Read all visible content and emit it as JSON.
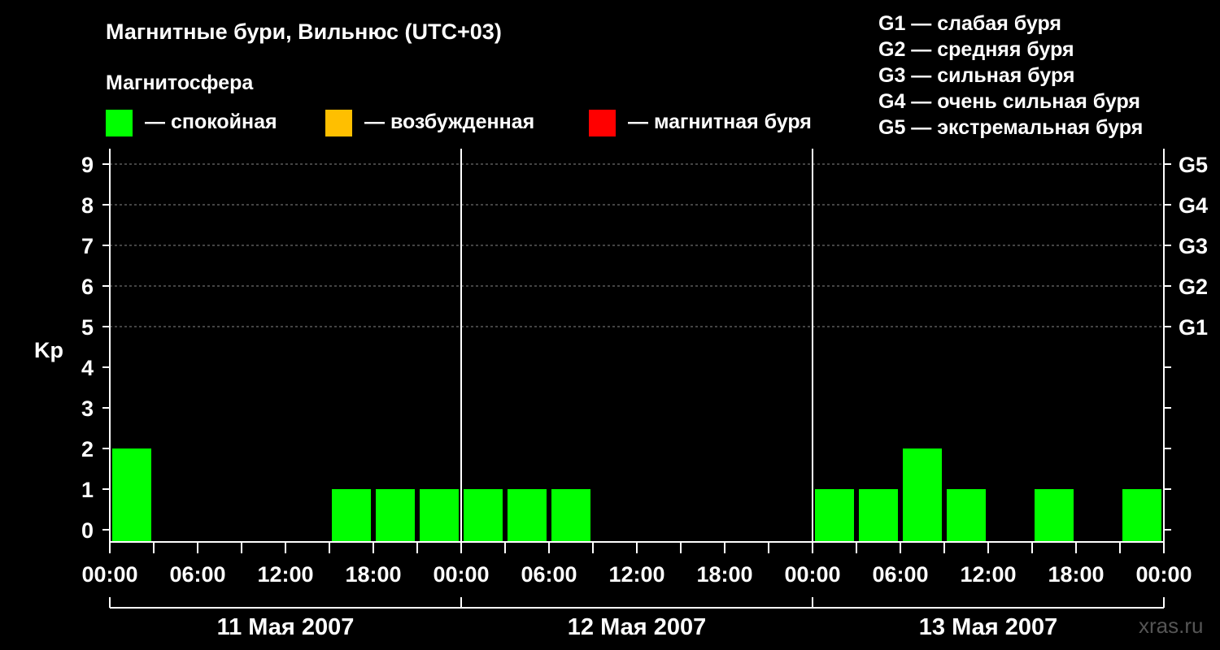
{
  "title": "Магнитные бури, Вильнюс (UTC+03)",
  "subtitle": "Магнитосфера",
  "state_legend": [
    {
      "label": "— спокойная",
      "color": "#00ff00"
    },
    {
      "label": "— возбужденная",
      "color": "#ffbf00"
    },
    {
      "label": "— магнитная буря",
      "color": "#ff0000"
    }
  ],
  "g_legend": [
    "G1 — слабая буря",
    "G2 — средняя буря",
    "G3 — сильная буря",
    "G4 — очень сильная буря",
    "G5 — экстремальная буря"
  ],
  "watermark": "xras.ru",
  "chart_data": {
    "type": "bar",
    "ylabel": "Kp",
    "ylim": [
      0,
      9
    ],
    "yticks": [
      "0",
      "1",
      "2",
      "3",
      "4",
      "5",
      "6",
      "7",
      "8",
      "9"
    ],
    "g_ticks": [
      {
        "kp": 5,
        "label": "G1"
      },
      {
        "kp": 6,
        "label": "G2"
      },
      {
        "kp": 7,
        "label": "G3"
      },
      {
        "kp": 8,
        "label": "G4"
      },
      {
        "kp": 9,
        "label": "G5"
      }
    ],
    "xtick_labels": [
      "00:00",
      "06:00",
      "12:00",
      "18:00",
      "00:00",
      "06:00",
      "12:00",
      "18:00",
      "00:00",
      "06:00",
      "12:00",
      "18:00",
      "00:00"
    ],
    "days": [
      "11 Мая 2007",
      "12 Мая 2007",
      "13 Мая 2007"
    ],
    "interval_hours": 3,
    "grid": true,
    "series": [
      {
        "values": [
          2,
          0,
          0,
          0,
          0,
          1,
          1,
          1,
          1,
          1,
          1,
          0,
          0,
          0,
          0,
          0,
          1,
          1,
          2,
          1,
          0,
          1,
          0,
          1
        ]
      }
    ]
  }
}
